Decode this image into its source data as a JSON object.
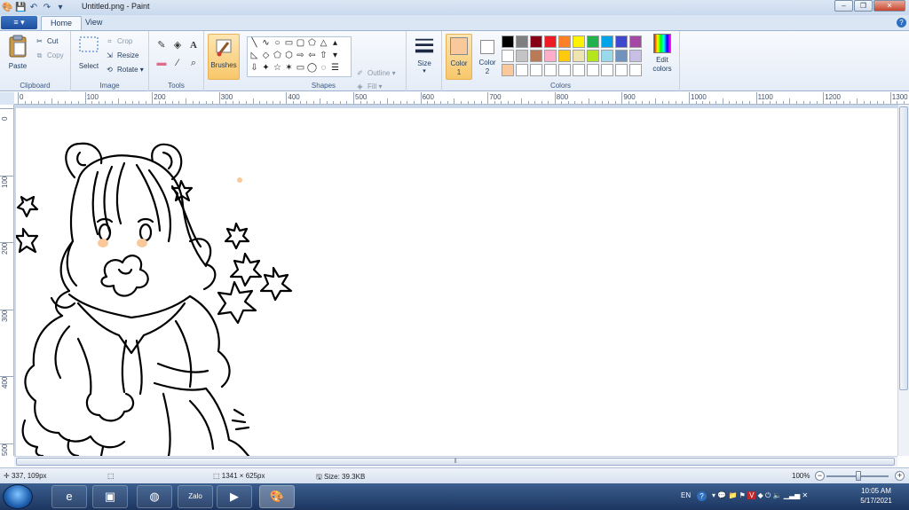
{
  "window": {
    "title": "Untitled.png - Paint",
    "controls": [
      "minimize",
      "maximize",
      "close"
    ],
    "control_glyphs": {
      "minimize": "–",
      "maximize": "❐",
      "close": "✕"
    }
  },
  "quick_access": {
    "icons": [
      "paint-app-icon",
      "save-icon",
      "undo-icon",
      "redo-icon",
      "customize-qat-icon"
    ],
    "glyphs": [
      "🎨",
      "💾",
      "↶",
      "↷",
      "▾"
    ]
  },
  "tabs": {
    "file_glyph": "≡ ▾",
    "home": "Home",
    "view": "View",
    "help_glyph": "?"
  },
  "ribbon": {
    "clipboard": {
      "label": "Clipboard",
      "paste": "Paste",
      "cut": "Cut",
      "copy": "Copy"
    },
    "image": {
      "label": "Image",
      "select": "Select",
      "crop": "Crop",
      "resize": "Resize",
      "rotate": "Rotate"
    },
    "tools": {
      "label": "Tools",
      "icons": [
        "pencil-icon",
        "fill-icon",
        "text-icon",
        "eraser-icon",
        "color-picker-icon",
        "magnifier-icon"
      ],
      "glyphs": [
        "✎",
        "◈",
        "A",
        "▬",
        "⁄",
        "⌕"
      ]
    },
    "brushes": {
      "label": "Brushes"
    },
    "shapes": {
      "label": "Shapes",
      "glyphs": [
        "╲",
        "∿",
        "○",
        "▭",
        "▢",
        "⬠",
        "△",
        "▴",
        "◺",
        "◇",
        "⬠",
        "⬡",
        "⇨",
        "⇦",
        "⇧",
        "▾",
        "⇩",
        "✦",
        "☆",
        "✶",
        "▭",
        "◯",
        "◌",
        "☰"
      ],
      "outline": "Outline",
      "fill": "Fill"
    },
    "size": {
      "label": "Size"
    },
    "colors": {
      "label": "Colors",
      "color1": {
        "label": "Color",
        "number": "1",
        "value": "#f9c99b"
      },
      "color2": {
        "label": "Color",
        "number": "2",
        "value": "#ffffff"
      },
      "palette": [
        "#000000",
        "#7f7f7f",
        "#880015",
        "#ed1c24",
        "#ff7f27",
        "#fff200",
        "#22b14c",
        "#00a2e8",
        "#3f48cc",
        "#a349a4",
        "#ffffff",
        "#c3c3c3",
        "#b97a57",
        "#ffaec9",
        "#ffc90e",
        "#efe4b0",
        "#b5e61d",
        "#99d9ea",
        "#7092be",
        "#c8bfe7",
        "#f9c99b",
        "#ffffff",
        "#ffffff",
        "#ffffff",
        "#ffffff",
        "#ffffff",
        "#ffffff",
        "#ffffff",
        "#ffffff",
        "#ffffff"
      ],
      "edit_colors": {
        "line1": "Edit",
        "line2": "colors"
      }
    }
  },
  "rulers": {
    "horizontal": [
      "0",
      "100",
      "200",
      "300",
      "400",
      "500",
      "600",
      "700",
      "800",
      "900",
      "1000",
      "1100",
      "1200",
      "1300"
    ],
    "vertical": [
      "0",
      "100",
      "200",
      "300",
      "400",
      "500"
    ]
  },
  "status": {
    "cursor_pos": "337, 109px",
    "selection_size": "",
    "image_size": "1341 × 625px",
    "file_size": "Size: 39.3KB",
    "zoom": "100%",
    "zoom_minus": "−",
    "zoom_plus": "+"
  },
  "taskbar": {
    "apps": [
      {
        "name": "internet-explorer-icon",
        "glyph": "e"
      },
      {
        "name": "monitor-app-icon",
        "glyph": "▣"
      },
      {
        "name": "coccoc-icon",
        "glyph": "◍"
      },
      {
        "name": "zalo-icon",
        "glyph": "Zalo"
      },
      {
        "name": "media-player-icon",
        "glyph": "▶"
      },
      {
        "name": "paint-taskbar-icon",
        "glyph": "🎨"
      }
    ],
    "language": "EN",
    "help_glyph": "?",
    "clock": {
      "time": "10:05 AM",
      "date": "5/17/2021"
    }
  },
  "accent": "#2f6fc0"
}
